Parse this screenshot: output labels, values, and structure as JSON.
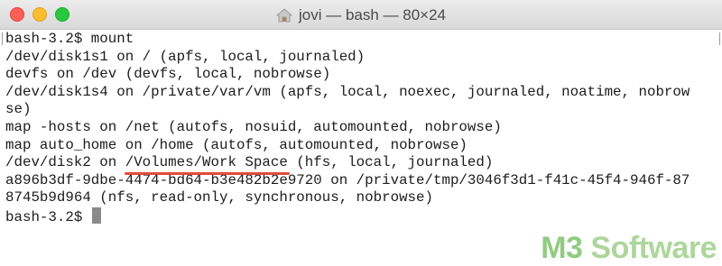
{
  "window": {
    "title": "jovi — bash — 80×24",
    "title_icon": "home-icon"
  },
  "terminal": {
    "lines": [
      {
        "text": "bash-3.2$ mount"
      },
      {
        "text": "/dev/disk1s1 on / (apfs, local, journaled)"
      },
      {
        "text": "devfs on /dev (devfs, local, nobrowse)"
      },
      {
        "text": "/dev/disk1s4 on /private/var/vm (apfs, local, noexec, journaled, noatime, nobrow"
      },
      {
        "text": "se)"
      },
      {
        "text": "map -hosts on /net (autofs, nosuid, automounted, nobrowse)"
      },
      {
        "text": "map auto_home on /home (autofs, automounted, nobrowse)"
      },
      {
        "prefix": "/dev/disk2 on ",
        "highlight": "/Volumes/Work Space",
        "suffix": " (hfs, local, journaled)"
      },
      {
        "text": "a896b3df-9dbe-4474-bd64-b3e482b2e9720 on /private/tmp/3046f3d1-f41c-45f4-946f-87"
      },
      {
        "text": "8745b9d964 (nfs, read-only, synchronous, nobrowse)"
      },
      {
        "text": "bash-3.2$ "
      }
    ]
  },
  "watermark": {
    "brand_m3": "M3",
    "brand_rest": " Software"
  },
  "colors": {
    "close": "#fe5f57",
    "minimize": "#febc2e",
    "maximize": "#28c840",
    "underline": "#e24b3b",
    "watermark": "#9fd08a"
  }
}
